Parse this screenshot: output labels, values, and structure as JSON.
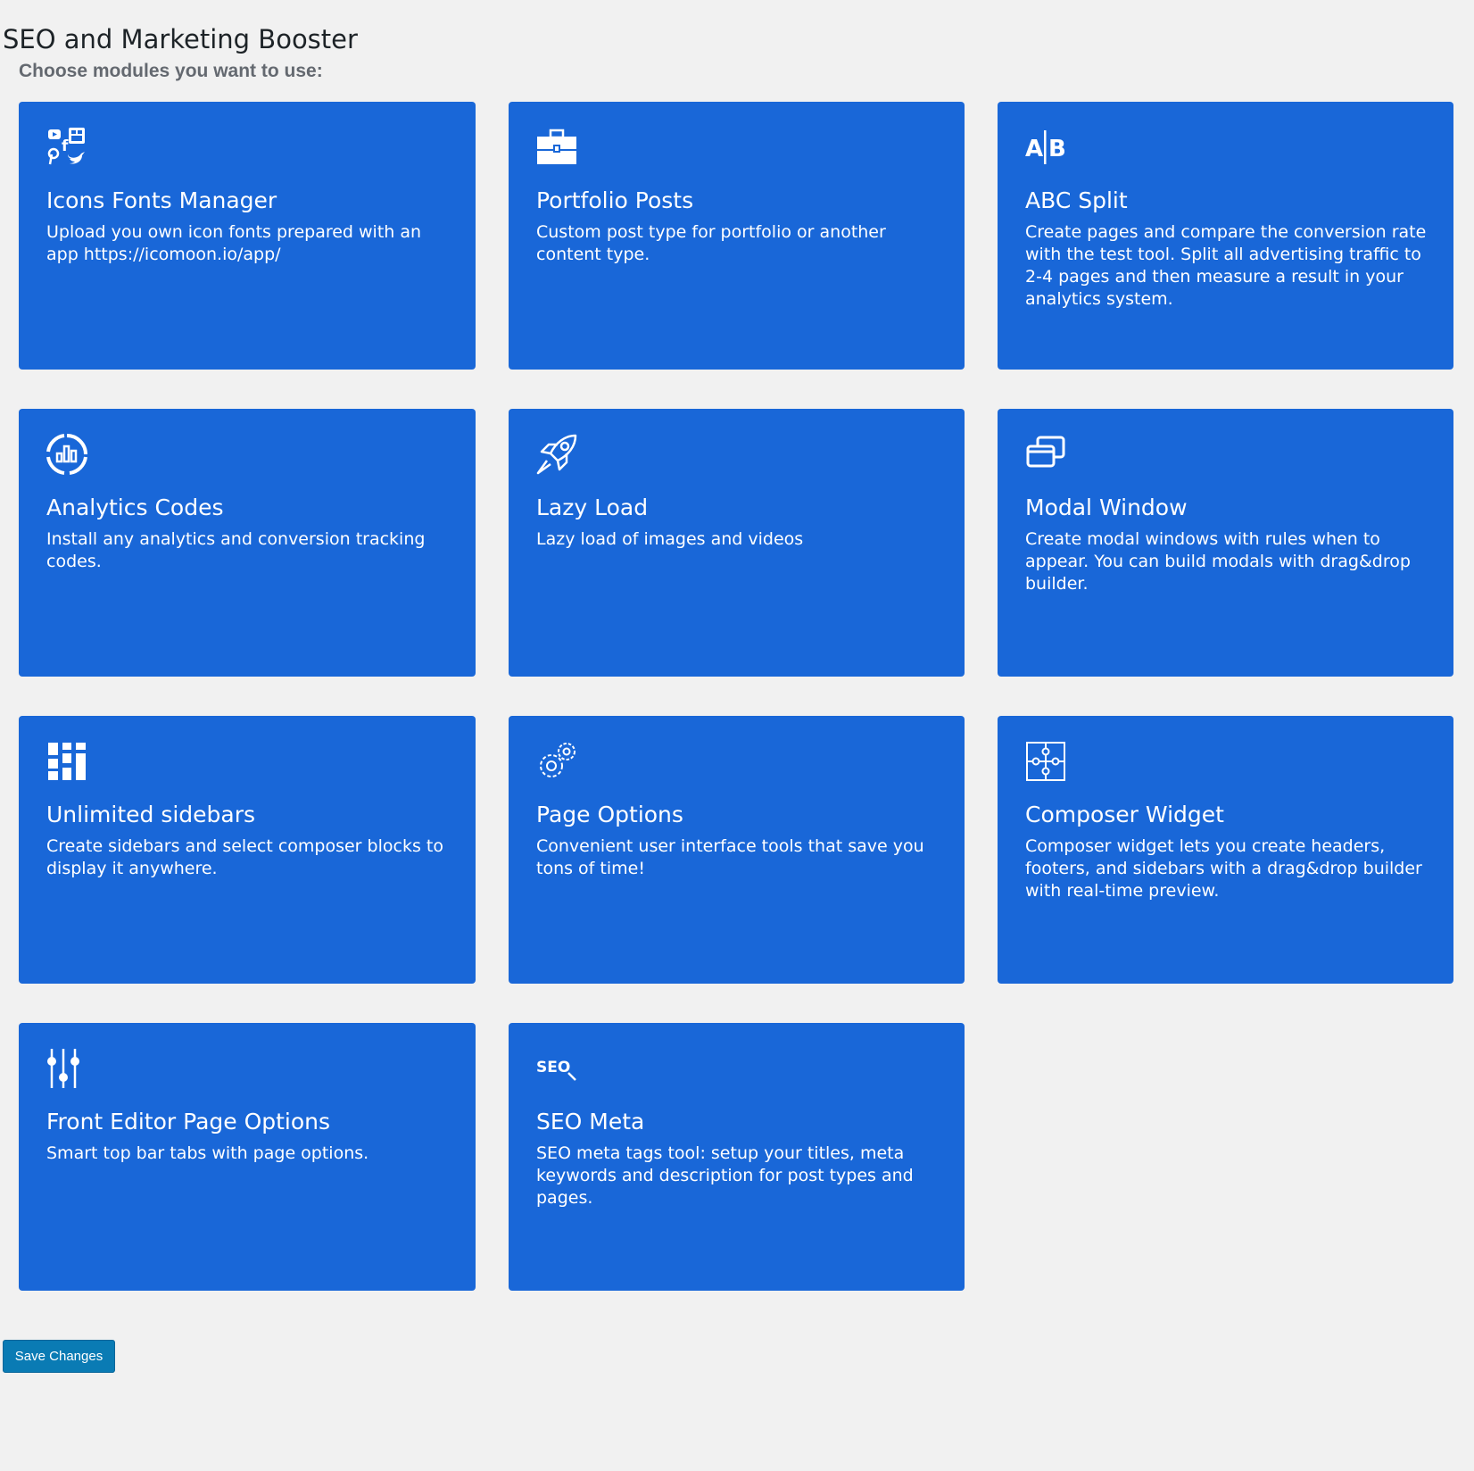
{
  "header": {
    "title": "SEO and Marketing Booster",
    "subtitle": "Choose modules you want to use:"
  },
  "modules": [
    {
      "icon": "social-icons-icon",
      "title": "Icons Fonts Manager",
      "description": "Upload you own icon fonts prepared with an app https://icomoon.io/app/"
    },
    {
      "icon": "briefcase-icon",
      "title": "Portfolio Posts",
      "description": "Custom post type for portfolio or another content type."
    },
    {
      "icon": "ab-split-icon",
      "title": "ABC Split",
      "description": "Create pages and compare the conversion rate with the test tool. Split all advertising traffic to 2-4 pages and then measure a result in your analytics system."
    },
    {
      "icon": "analytics-chart-icon",
      "title": "Analytics Codes",
      "description": "Install any analytics and conversion tracking codes."
    },
    {
      "icon": "rocket-icon",
      "title": "Lazy Load",
      "description": "Lazy load of images and videos"
    },
    {
      "icon": "windows-icon",
      "title": "Modal Window",
      "description": "Create modal windows with rules when to appear. You can build modals with drag&drop builder."
    },
    {
      "icon": "sidebars-icon",
      "title": "Unlimited sidebars",
      "description": "Create sidebars and select composer blocks to display it anywhere."
    },
    {
      "icon": "gears-icon",
      "title": "Page Options",
      "description": "Convenient user interface tools that save you tons of time!"
    },
    {
      "icon": "puzzle-icon",
      "title": "Composer Widget",
      "description": "Composer widget lets you create headers, footers, and sidebars with a drag&drop builder with real-time preview."
    },
    {
      "icon": "sliders-icon",
      "title": "Front Editor Page Options",
      "description": "Smart top bar tabs with page options."
    },
    {
      "icon": "seo-search-icon",
      "title": "SEO Meta",
      "description": "SEO meta tags tool: setup your titles, meta keywords and description for post types and pages."
    }
  ],
  "icon_labels": {
    "ab_left": "A",
    "ab_right": "B",
    "seo_text": "SEO",
    "social_f": "f"
  },
  "actions": {
    "save_label": "Save Changes"
  },
  "colors": {
    "card_background": "#1967d8",
    "page_background": "#f1f1f1",
    "save_button": "#0a7bb4"
  }
}
